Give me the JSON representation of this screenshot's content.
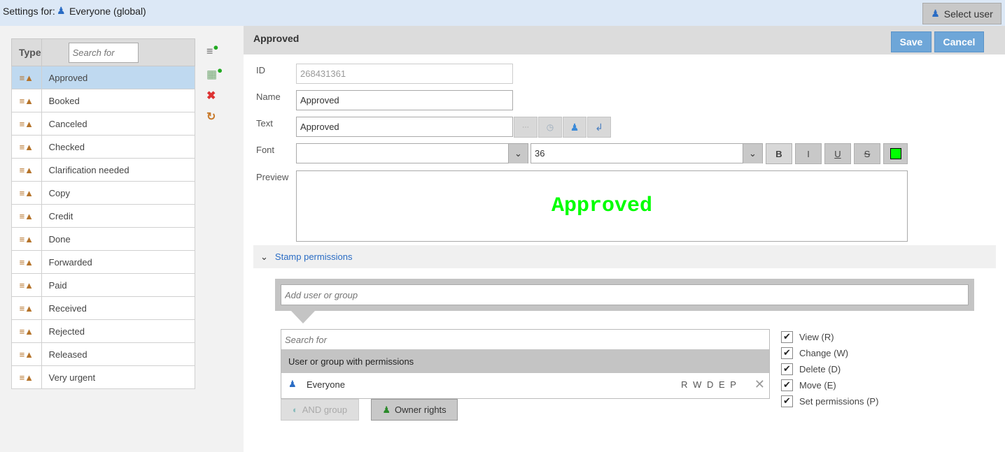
{
  "header": {
    "settings_for": "Settings for:",
    "scope": "Everyone (global)",
    "select_user": "Select user"
  },
  "list": {
    "type_header": "Type",
    "search_placeholder": "Search for",
    "items": [
      "Approved",
      "Booked",
      "Canceled",
      "Checked",
      "Clarification needed",
      "Copy",
      "Credit",
      "Done",
      "Forwarded",
      "Paid",
      "Received",
      "Rejected",
      "Released",
      "Very urgent"
    ],
    "selected": "Approved"
  },
  "detail": {
    "title": "Approved",
    "save": "Save",
    "cancel": "Cancel",
    "id_label": "ID",
    "id_value": "268431361",
    "name_label": "Name",
    "name_value": "Approved",
    "text_label": "Text",
    "text_value": "Approved",
    "font_label": "Font",
    "font_value": "",
    "size_value": "36",
    "bold": "B",
    "italic": "I",
    "underline": "U",
    "strike": "S",
    "font_color": "#00ff00",
    "preview_label": "Preview",
    "preview_text": "Approved"
  },
  "permissions": {
    "section": "Stamp permissions",
    "add_placeholder": "Add user or group",
    "search_placeholder": "Search for",
    "list_header": "User or group with permissions",
    "entries": [
      {
        "name": "Everyone",
        "rights": "R W D E P"
      }
    ],
    "and_group": "AND group",
    "owner_rights": "Owner rights",
    "checks": [
      {
        "label": "View (R)",
        "checked": true
      },
      {
        "label": "Change (W)",
        "checked": true
      },
      {
        "label": "Delete (D)",
        "checked": true
      },
      {
        "label": "Move (E)",
        "checked": true
      },
      {
        "label": "Set permissions (P)",
        "checked": true
      }
    ]
  }
}
